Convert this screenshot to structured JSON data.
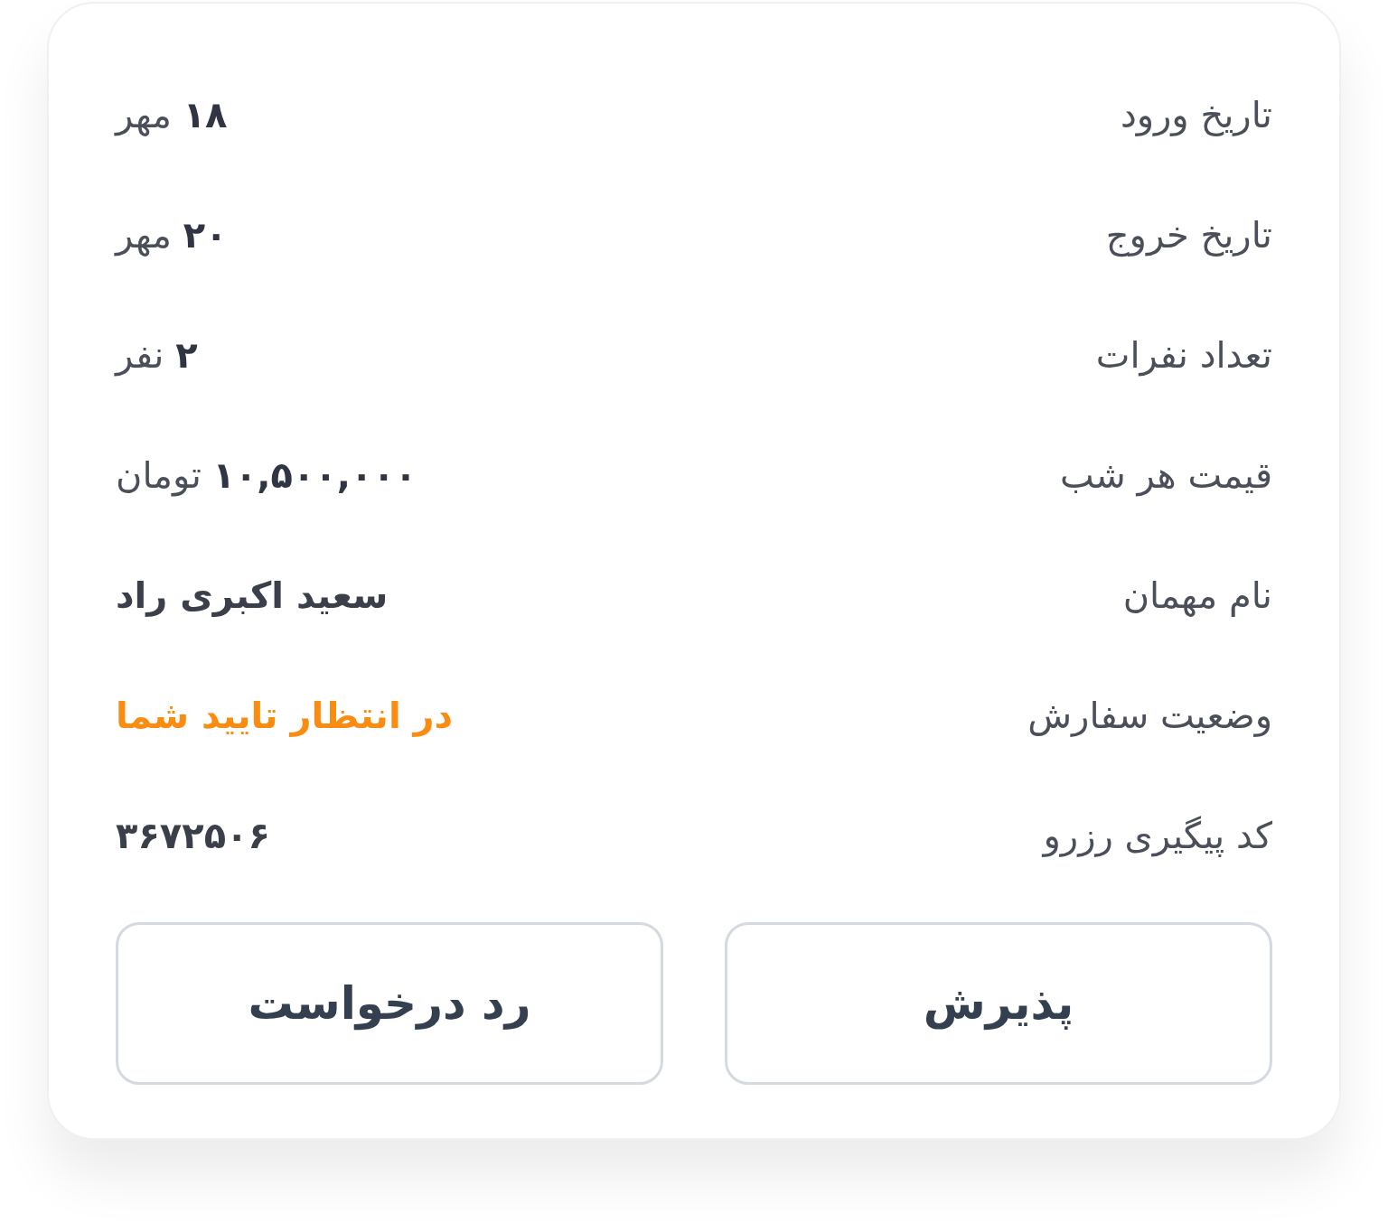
{
  "details": [
    {
      "label": "تاریخ ورود",
      "value": "**۱۸** مهر",
      "kind": "mixed"
    },
    {
      "label": "تاریخ خروج",
      "value": "**۲۰** مهر",
      "kind": "mixed"
    },
    {
      "label": "تعداد نفرات",
      "value": "**۲** نفر",
      "kind": "mixed"
    },
    {
      "label": "قیمت هر شب",
      "value": "**۱۰,۵۰۰,۰۰۰** تومان",
      "kind": "mixed"
    },
    {
      "label": "نام مهمان",
      "value": "سعید اکبری راد",
      "kind": "strong"
    },
    {
      "label": "وضعیت سفارش",
      "value": "در انتظار تایید شما",
      "kind": "status"
    },
    {
      "label": "کد پیگیری رزرو",
      "value": "۳۶۷۲۵۰۶",
      "kind": "strong"
    }
  ],
  "buttons": [
    "پذیرش",
    "رد درخواست"
  ]
}
